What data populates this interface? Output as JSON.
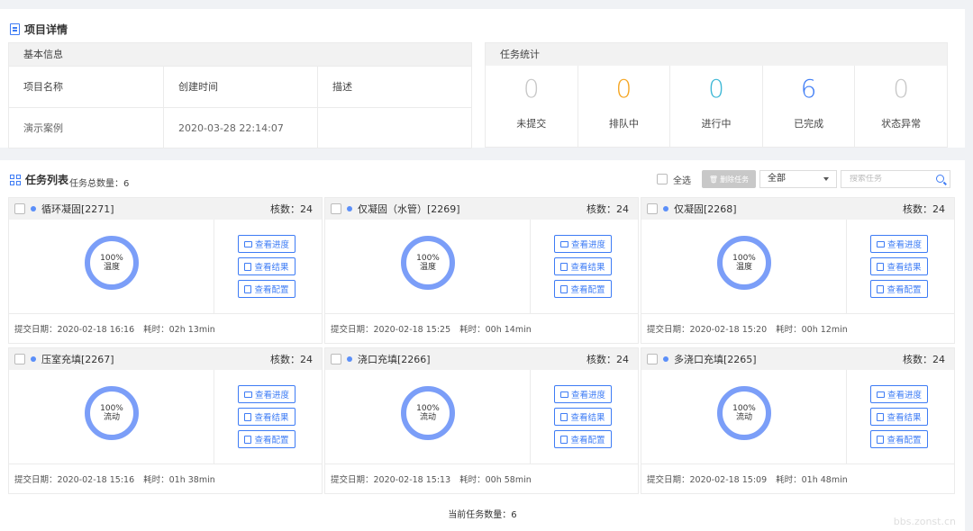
{
  "detail": {
    "title": "项目详情",
    "basic": {
      "header": "基本信息",
      "columns": [
        "项目名称",
        "创建时间",
        "描述"
      ],
      "values": [
        "演示案例",
        "2020-03-28 22:14:07",
        ""
      ]
    },
    "stats": {
      "header": "任务统计",
      "items": [
        {
          "value": "0",
          "label": "未提交",
          "color": "#c8c8c8"
        },
        {
          "value": "0",
          "label": "排队中",
          "color": "#f5a623"
        },
        {
          "value": "0",
          "label": "进行中",
          "color": "#3fb8d6"
        },
        {
          "value": "6",
          "label": "已完成",
          "color": "#3e7cf5"
        },
        {
          "value": "0",
          "label": "状态异常",
          "color": "#c8c8c8"
        }
      ]
    }
  },
  "list": {
    "title": "任务列表",
    "count_label": "任务总数量：6",
    "select_all": "全选",
    "delete_label": "删除任务",
    "filter_value": "全部",
    "search_placeholder": "搜索任务",
    "bottom_count": "当前任务数量：6",
    "actions": [
      "查看进度",
      "查看结果",
      "查看配置"
    ],
    "tasks": [
      {
        "name": "循环凝固[2271]",
        "cores": "核数：24",
        "pct": "100%",
        "kind": "温度",
        "date": "提交日期：2020-02-18 16:16",
        "elapsed": "耗时：02h 13min"
      },
      {
        "name": "仅凝固（水管）[2269]",
        "cores": "核数：24",
        "pct": "100%",
        "kind": "温度",
        "date": "提交日期：2020-02-18 15:25",
        "elapsed": "耗时：00h 14min"
      },
      {
        "name": "仅凝固[2268]",
        "cores": "核数：24",
        "pct": "100%",
        "kind": "温度",
        "date": "提交日期：2020-02-18 15:20",
        "elapsed": "耗时：00h 12min"
      },
      {
        "name": "压室充填[2267]",
        "cores": "核数：24",
        "pct": "100%",
        "kind": "流动",
        "date": "提交日期：2020-02-18 15:16",
        "elapsed": "耗时：01h 38min"
      },
      {
        "name": "浇口充填[2266]",
        "cores": "核数：24",
        "pct": "100%",
        "kind": "流动",
        "date": "提交日期：2020-02-18 15:13",
        "elapsed": "耗时：00h 58min"
      },
      {
        "name": "多浇口充填[2265]",
        "cores": "核数：24",
        "pct": "100%",
        "kind": "流动",
        "date": "提交日期：2020-02-18 15:09",
        "elapsed": "耗时：01h 48min"
      }
    ]
  },
  "watermark": "bbs.zonst.cn"
}
